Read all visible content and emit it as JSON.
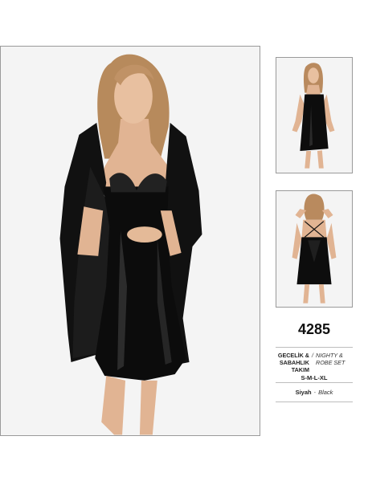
{
  "product": {
    "code": "4285",
    "type_tr": "GECELİK & SABAHLIK TAKIM",
    "type_separator": "/",
    "type_en": "NIGHTY & ROBE SET",
    "sizes": "S-M-L-XL",
    "color_tr": "Siyah",
    "color_separator": "-",
    "color_en": "Black"
  },
  "images": {
    "main": "model-wearing-black-satin-nightgown-and-robe",
    "thumb_front": "model-front-view-black-nightgown",
    "thumb_back": "model-back-view-black-nightgown"
  },
  "colors": {
    "garment": "#0d0d0d",
    "skin": "#e2b898",
    "hair": "#b98a5e",
    "frame_border": "#9a9a9a"
  }
}
